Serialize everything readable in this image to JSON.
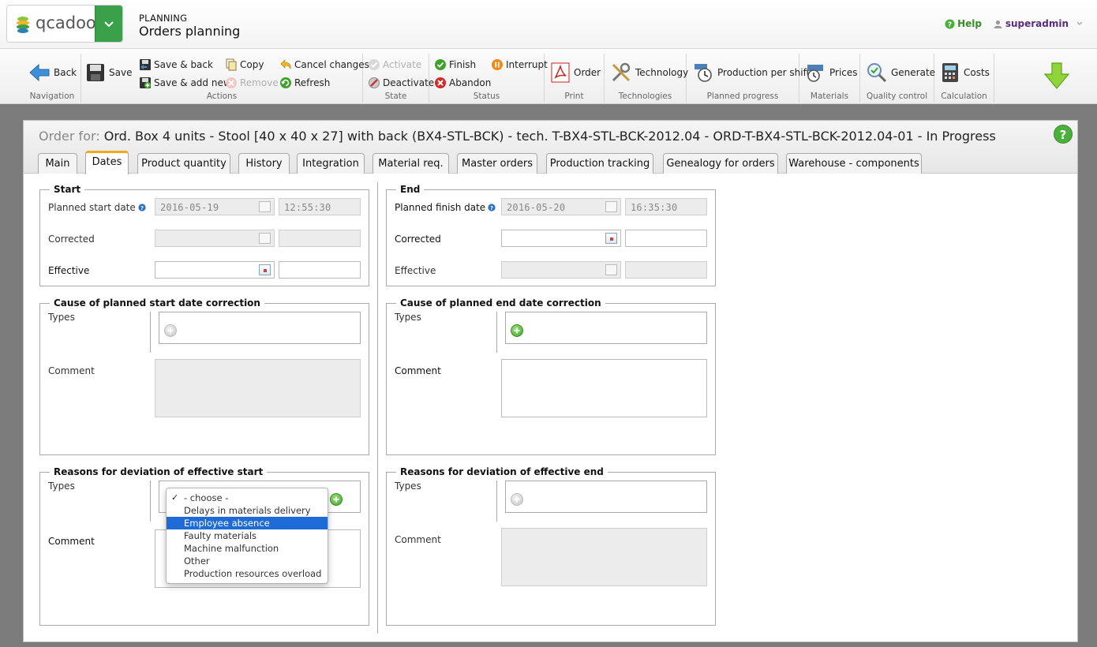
{
  "header": {
    "logo_text": "qcadoo",
    "module": "PLANNING",
    "page": "Orders planning",
    "help": "Help",
    "user": "superadmin"
  },
  "ribbon": {
    "navigation": {
      "title": "Navigation",
      "back": "Back"
    },
    "actions": {
      "title": "Actions",
      "save": "Save",
      "save_back": "Save & back",
      "save_add": "Save & add new",
      "copy": "Copy",
      "remove": "Remove",
      "cancel": "Cancel changes",
      "refresh": "Refresh"
    },
    "state": {
      "title": "State",
      "activate": "Activate",
      "deactivate": "Deactivate"
    },
    "status": {
      "title": "Status",
      "finish": "Finish",
      "abandon": "Abandon",
      "interrupt": "Interrupt"
    },
    "print": {
      "title": "Print",
      "order": "Order"
    },
    "technologies": {
      "title": "Technologies",
      "technology": "Technology"
    },
    "planned_progress": {
      "title": "Planned progress",
      "production_per_shift": "Production per shift"
    },
    "materials": {
      "title": "Materials",
      "prices": "Prices"
    },
    "quality": {
      "title": "Quality control",
      "generate": "Generate"
    },
    "calculation": {
      "title": "Calculation",
      "costs": "Costs"
    }
  },
  "order": {
    "label": "Order for:",
    "title": "Ord. Box 4 units - Stool [40 x 40 x 27] with back (BX4-STL-BCK) - tech. T-BX4-STL-BCK-2012.04 - ORD-T-BX4-STL-BCK-2012.04-01 - In Progress"
  },
  "tabs": [
    "Main",
    "Dates",
    "Product quantity",
    "History",
    "Integration",
    "Material req.",
    "Master orders",
    "Production tracking",
    "Genealogy for orders",
    "Warehouse - components"
  ],
  "start": {
    "legend": "Start",
    "planned_label": "Planned start date",
    "planned_date": "2016-05-19",
    "planned_time": "12:55:30",
    "corrected_label": "Corrected",
    "effective_label": "Effective"
  },
  "end": {
    "legend": "End",
    "planned_label": "Planned finish date",
    "planned_date": "2016-05-20",
    "planned_time": "16:35:30",
    "corrected_label": "Corrected",
    "effective_label": "Effective"
  },
  "cause_start": {
    "legend": "Cause of planned start date correction",
    "types": "Types",
    "comment": "Comment"
  },
  "cause_end": {
    "legend": "Cause of planned end date correction",
    "types": "Types",
    "comment": "Comment"
  },
  "reason_start": {
    "legend": "Reasons for deviation of effective start",
    "types": "Types",
    "comment": "Comment"
  },
  "reason_end": {
    "legend": "Reasons for deviation of effective end",
    "types": "Types",
    "comment": "Comment"
  },
  "dropdown": {
    "options": [
      "- choose -",
      "Delays in materials delivery",
      "Employee absence",
      "Faulty materials",
      "Machine malfunction",
      "Other",
      "Production resources overload"
    ]
  },
  "colors": {
    "brand_green": "#3aa14a",
    "tab_active": "#f0a81c",
    "dropdown_highlight": "#1e6bd8"
  }
}
